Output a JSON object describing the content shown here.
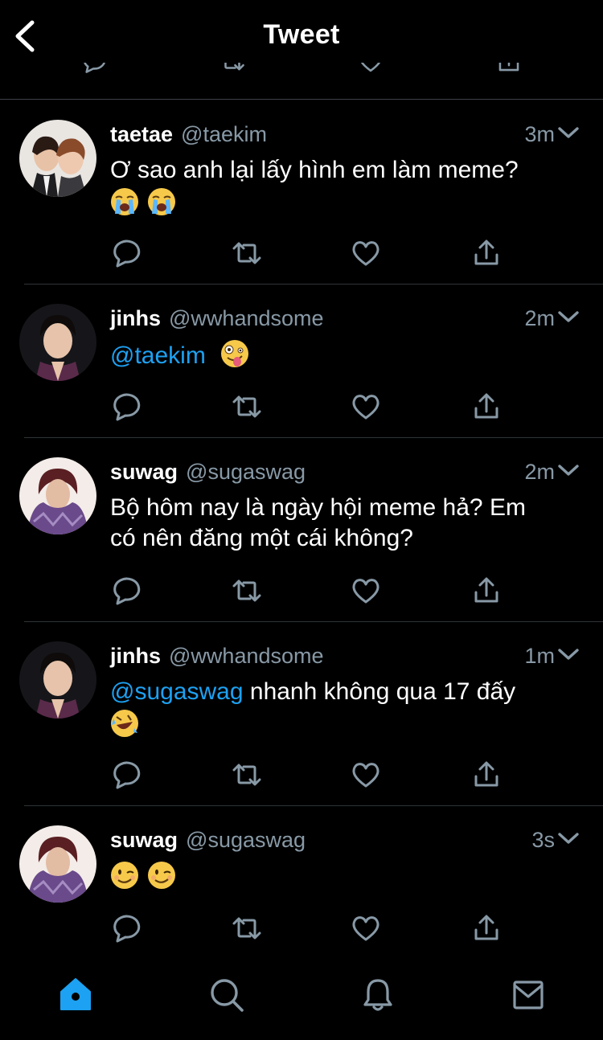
{
  "header": {
    "title": "Tweet"
  },
  "tweets": [
    {
      "name": "taetae",
      "handle": "@taekim",
      "time": "3m",
      "text": "Ơ sao anh lại lấy hình em làm meme?",
      "emojis": [
        "loudly-crying-face",
        "loudly-crying-face"
      ]
    },
    {
      "name": "jinhs",
      "handle": "@wwhandsome",
      "time": "2m",
      "mention": "@taekim",
      "emojis": [
        "zany-face"
      ]
    },
    {
      "name": "suwag",
      "handle": "@sugaswag",
      "time": "2m",
      "text_line1": "Bộ hôm nay là ngày hội meme hả? Em",
      "text_line2": "có nên đăng một cái không?"
    },
    {
      "name": "jinhs",
      "handle": "@wwhandsome",
      "time": "1m",
      "mention": "@sugaswag",
      "text": " nhanh không qua 17 đấy",
      "emojis": [
        "rolling-on-floor-laughing-face"
      ]
    },
    {
      "name": "suwag",
      "handle": "@sugaswag",
      "time": "3s",
      "emojis": [
        "winking-face",
        "winking-face"
      ]
    }
  ],
  "icons": {
    "back": "chevron-left-icon",
    "reply": "reply-icon",
    "retweet": "retweet-icon",
    "like": "heart-icon",
    "share": "share-icon",
    "more": "chevron-down-icon",
    "home": "home-icon",
    "search": "search-icon",
    "notifications": "bell-icon",
    "messages": "mail-icon"
  },
  "colors": {
    "background": "#000000",
    "accent": "#1da1f2",
    "muted": "#8899a6",
    "divider": "#2f3336"
  }
}
